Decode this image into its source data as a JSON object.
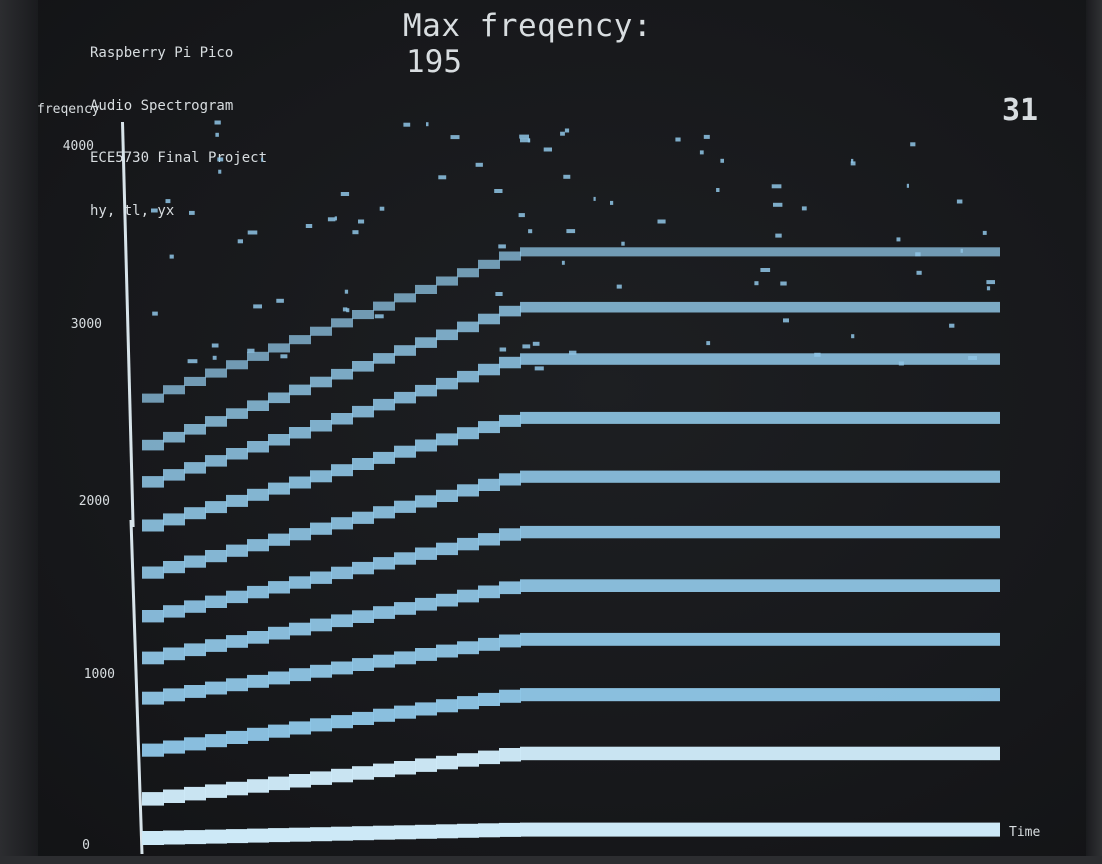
{
  "header": {
    "lines": [
      "Raspberry Pi Pico",
      "Audio Spectrogram",
      "ECE5730 Final Project",
      "hy, tl, yx"
    ],
    "max_frequency_label": "Max freqency:",
    "max_frequency_value": "195",
    "counter_value": "31"
  },
  "chart_data": {
    "type": "heatmap",
    "ylabel": "freqency",
    "xlabel": "Time",
    "y_ticks": [
      "4000",
      "3000",
      "2000",
      "1000",
      "0"
    ],
    "y_tick_values": [
      4000,
      3000,
      2000,
      1000,
      0
    ],
    "ylim": [
      0,
      4000
    ],
    "grid": false,
    "band_color": "#8fc6e6",
    "band_color_bright": "#cde9f7",
    "harmonics": [
      {
        "start_hz": 10,
        "end_hz": 60,
        "strength": 1.0
      },
      {
        "start_hz": 230,
        "end_hz": 500,
        "strength": 0.95
      },
      {
        "start_hz": 510,
        "end_hz": 840,
        "strength": 0.9
      },
      {
        "start_hz": 810,
        "end_hz": 1160,
        "strength": 0.88
      },
      {
        "start_hz": 1040,
        "end_hz": 1470,
        "strength": 0.86
      },
      {
        "start_hz": 1280,
        "end_hz": 1780,
        "strength": 0.82
      },
      {
        "start_hz": 1530,
        "end_hz": 2100,
        "strength": 0.8
      },
      {
        "start_hz": 1800,
        "end_hz": 2440,
        "strength": 0.78
      },
      {
        "start_hz": 2050,
        "end_hz": 2780,
        "strength": 0.72
      },
      {
        "start_hz": 2260,
        "end_hz": 3080,
        "strength": 0.62
      },
      {
        "start_hz": 2530,
        "end_hz": 3400,
        "strength": 0.45
      }
    ]
  }
}
